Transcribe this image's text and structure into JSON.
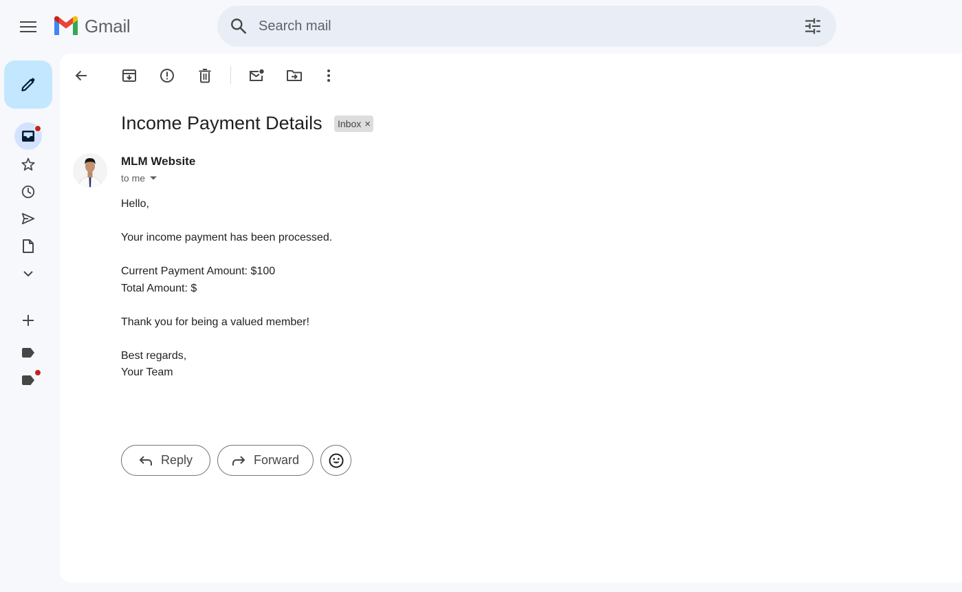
{
  "app": {
    "name": "Gmail"
  },
  "search": {
    "placeholder": "Search mail"
  },
  "rail": {
    "compose_icon": "pencil-icon",
    "items": [
      {
        "icon": "inbox-icon",
        "active": true,
        "badge": true
      },
      {
        "icon": "star-icon",
        "active": false,
        "badge": false
      },
      {
        "icon": "clock-icon",
        "active": false,
        "badge": false
      },
      {
        "icon": "send-icon",
        "active": false,
        "badge": false
      },
      {
        "icon": "draft-icon",
        "active": false,
        "badge": false
      },
      {
        "icon": "chevron-down-icon",
        "active": false,
        "badge": false
      },
      {
        "icon": "plus-icon",
        "active": false,
        "badge": false
      },
      {
        "icon": "label-icon",
        "active": false,
        "badge": false
      },
      {
        "icon": "label-icon",
        "active": false,
        "badge": true
      }
    ]
  },
  "toolbar": {
    "icons": [
      "back-arrow-icon",
      "archive-icon",
      "report-spam-icon",
      "delete-icon",
      "mark-unread-icon",
      "move-to-icon",
      "more-vert-icon"
    ]
  },
  "email": {
    "subject": "Income Payment Details",
    "label": "Inbox",
    "label_remove": "×",
    "sender": "MLM Website",
    "recipient": "to me",
    "body": [
      "Hello,",
      "",
      "Your income payment has been processed.",
      "",
      "Current Payment Amount: $100",
      "Total Amount: $",
      "",
      "Thank you for being a valued member!",
      "",
      "Best regards,",
      "Your Team"
    ]
  },
  "actions": {
    "reply": "Reply",
    "forward": "Forward",
    "emoji_icon": "emoji-icon"
  },
  "colors": {
    "background": "#f6f8fc",
    "panel": "#ffffff",
    "compose": "#c2e7ff",
    "active_rail": "#d3e3fd",
    "search_bg": "#e9eef6",
    "badge": "#c5221f"
  }
}
